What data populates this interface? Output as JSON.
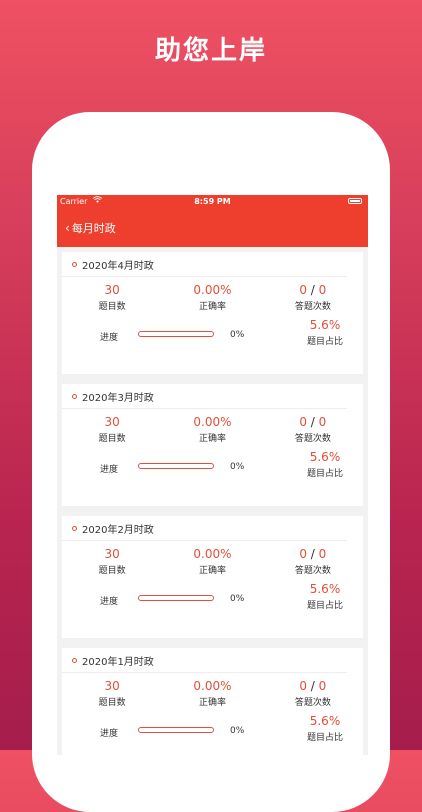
{
  "headline": "助您上岸",
  "status_bar": {
    "carrier": "Carrier",
    "time": "8:59 PM"
  },
  "nav": {
    "back_icon": "‹",
    "title": "每月时政"
  },
  "cards": [
    {
      "title": "2020年4月时政",
      "questions": "30",
      "questions_label": "题目数",
      "accuracy": "0.00%",
      "accuracy_label": "正确率",
      "answered": "0",
      "answered_total": "0",
      "answered_label": "答题次数",
      "progress_label": "进度",
      "progress": 0,
      "progress_text": "0%",
      "ratio": "5.6%",
      "ratio_label": "题目占比"
    },
    {
      "title": "2020年3月时政",
      "questions": "30",
      "questions_label": "题目数",
      "accuracy": "0.00%",
      "accuracy_label": "正确率",
      "answered": "0",
      "answered_total": "0",
      "answered_label": "答题次数",
      "progress_label": "进度",
      "progress": 0,
      "progress_text": "0%",
      "ratio": "5.6%",
      "ratio_label": "题目占比"
    },
    {
      "title": "2020年2月时政",
      "questions": "30",
      "questions_label": "题目数",
      "accuracy": "0.00%",
      "accuracy_label": "正确率",
      "answered": "0",
      "answered_total": "0",
      "answered_label": "答题次数",
      "progress_label": "进度",
      "progress": 0,
      "progress_text": "0%",
      "ratio": "5.6%",
      "ratio_label": "题目占比"
    },
    {
      "title": "2020年1月时政",
      "questions": "30",
      "questions_label": "题目数",
      "accuracy": "0.00%",
      "accuracy_label": "正确率",
      "answered": "0",
      "answered_total": "0",
      "answered_label": "答题次数",
      "progress_label": "进度",
      "progress": 0,
      "progress_text": "0%",
      "ratio": "5.6%",
      "ratio_label": "题目占比"
    }
  ],
  "colors": {
    "accent": "#e0503a",
    "navbar": "#ee3f2e"
  }
}
